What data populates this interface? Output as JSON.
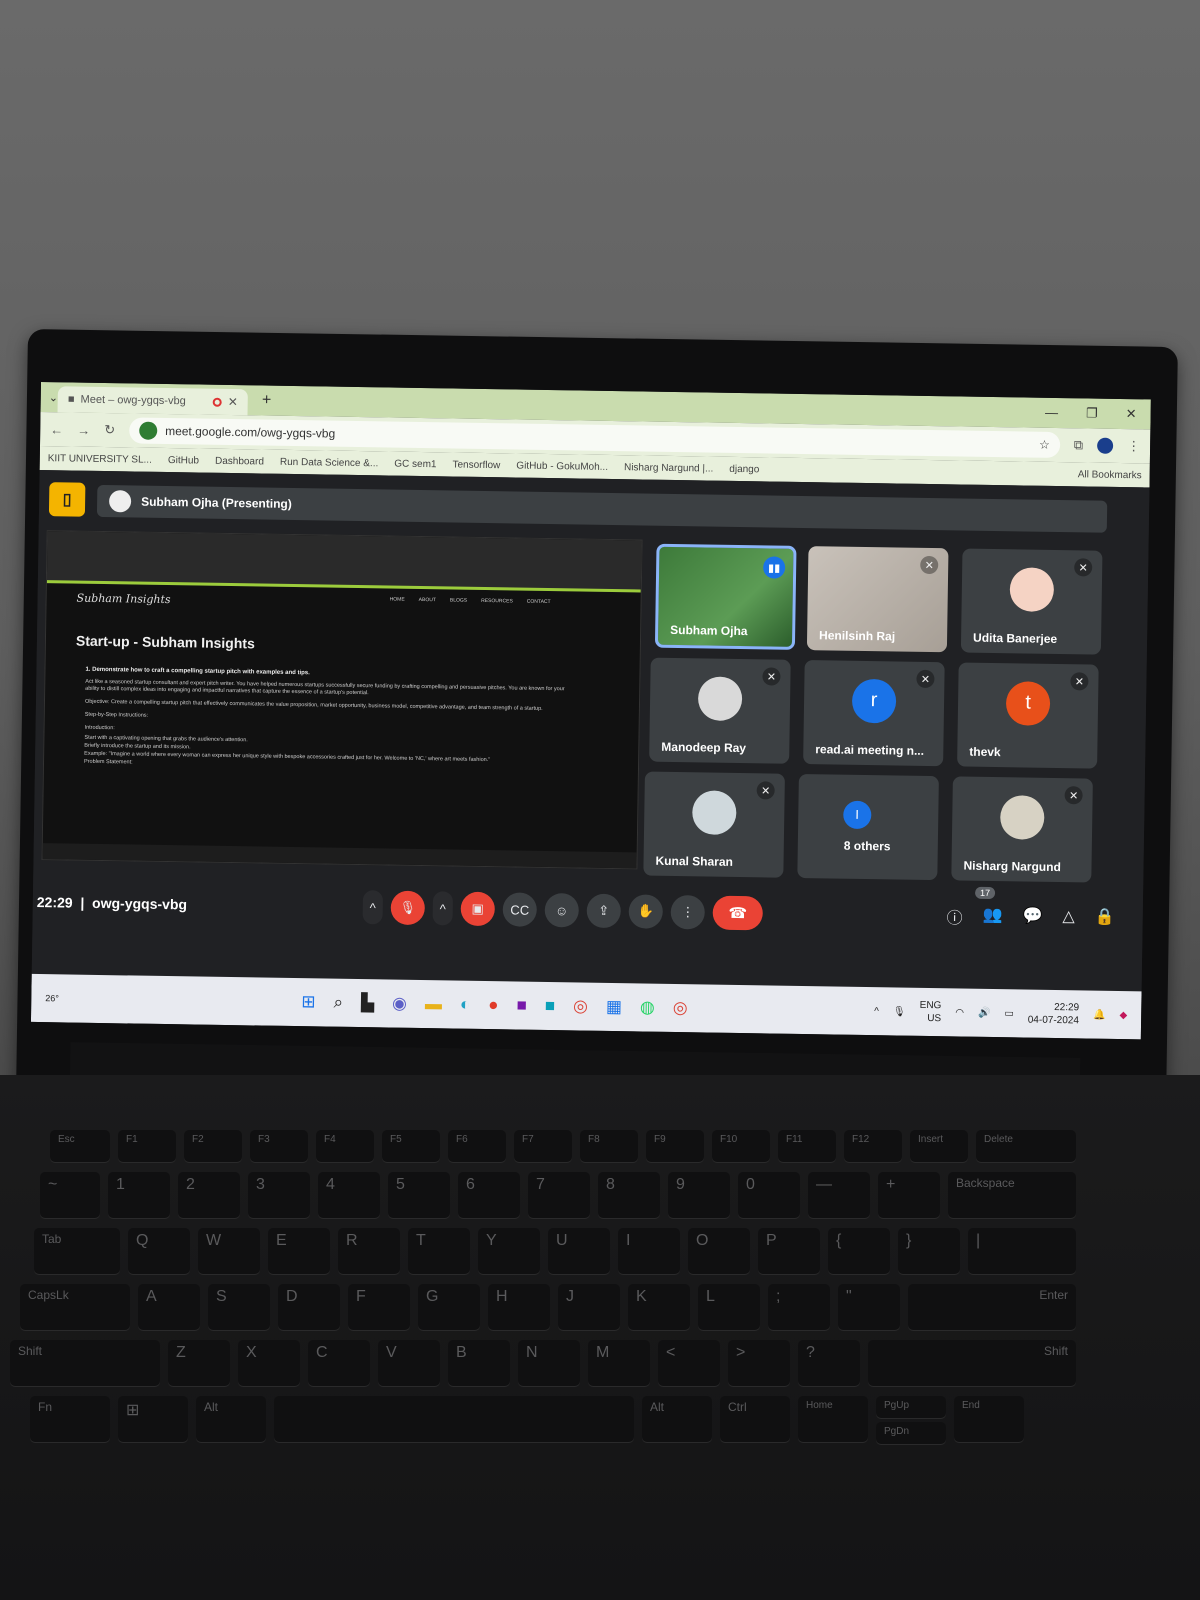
{
  "browser": {
    "tab_title": "Meet – owg-ygqs-vbg",
    "url": "meet.google.com/owg-ygqs-vbg",
    "bookmarks": [
      "KIIT UNIVERSITY SL...",
      "GitHub",
      "Dashboard",
      "Run Data Science &...",
      "GC sem1",
      "Tensorflow",
      "GitHub - GokuMoh...",
      "Nisharg Nargund |...",
      "django"
    ],
    "all_bookmarks": "All Bookmarks"
  },
  "meet": {
    "presenter": "Subham Ojha (Presenting)",
    "shared": {
      "nav": [
        "HOME",
        "ABOUT",
        "BLOGS",
        "RESOURCES",
        "CONTACT"
      ],
      "logo": "Subham Insights",
      "title": "Start-up - Subham Insights",
      "heading": "1. Demonstrate how to craft a compelling startup pitch with examples and tips.",
      "paragraphs": [
        "Act like a seasoned startup consultant and expert pitch writer. You have helped numerous startups successfully secure funding by crafting compelling and persuasive pitches. You are known for your ability to distill complex ideas into engaging and impactful narratives that capture the essence of a startup's potential.",
        "Objective: Create a compelling startup pitch that effectively communicates the value proposition, market opportunity, business model, competitive advantage, and team strength of a startup.",
        "Step-by-Step Instructions:",
        "Introduction:",
        "Start with a captivating opening that grabs the audience's attention.",
        "Briefly introduce the startup and its mission.",
        "Example: \"Imagine a world where every woman can express her unique style with bespoke accessories crafted just for her. Welcome to 'NC,' where art meets fashion.\"",
        "Problem Statement:"
      ]
    },
    "participants": [
      {
        "name": "Subham Ojha",
        "type": "video-speaking"
      },
      {
        "name": "Henilsinh Raj",
        "type": "video"
      },
      {
        "name": "Udita Banerjee",
        "type": "avatar",
        "color": "#f5d3c4"
      },
      {
        "name": "Manodeep Ray",
        "type": "avatar",
        "color": "#d9d9d9"
      },
      {
        "name": "read.ai meeting n...",
        "type": "initial",
        "initial": "r",
        "color": "#1a73e8"
      },
      {
        "name": "thevk",
        "type": "initial",
        "initial": "t",
        "color": "#e8501a"
      },
      {
        "name": "Kunal Sharan",
        "type": "avatar",
        "color": "#cfd8dc"
      },
      {
        "name": "8 others",
        "type": "group",
        "initial": "I",
        "color": "#1a73e8"
      },
      {
        "name": "Nisharg Nargund",
        "type": "avatar",
        "color": "#d7d2c4"
      }
    ],
    "time": "22:29",
    "meeting_code": "owg-ygqs-vbg",
    "people_count": "17"
  },
  "taskbar": {
    "temp": "26°",
    "lang": "ENG",
    "region": "US",
    "clock_time": "22:29",
    "clock_date": "04-07-2024"
  },
  "keyboard": {
    "row1": [
      "Esc",
      "F1",
      "F2",
      "F3",
      "F4",
      "F5",
      "F6",
      "F7",
      "F8",
      "F9",
      "F10",
      "F11",
      "F12",
      "Insert",
      "Delete"
    ],
    "row2": [
      "~",
      "1",
      "2",
      "3",
      "4",
      "5",
      "6",
      "7",
      "8",
      "9",
      "0",
      "—",
      "+",
      "Backspace"
    ],
    "row3": [
      "Tab",
      "Q",
      "W",
      "E",
      "R",
      "T",
      "Y",
      "U",
      "I",
      "O",
      "P",
      "{",
      "}",
      "|"
    ],
    "row4": [
      "CapsLk",
      "A",
      "S",
      "D",
      "F",
      "G",
      "H",
      "J",
      "K",
      "L",
      ";",
      "\"",
      "Enter"
    ],
    "row5": [
      "Shift",
      "Z",
      "X",
      "C",
      "V",
      "B",
      "N",
      "M",
      "<",
      ">",
      "?",
      "Shift"
    ],
    "row6": [
      "Fn",
      "⊞",
      "Alt",
      "",
      "Alt",
      "Ctrl",
      "Home",
      "PgUp",
      "PgDn",
      "End"
    ]
  }
}
